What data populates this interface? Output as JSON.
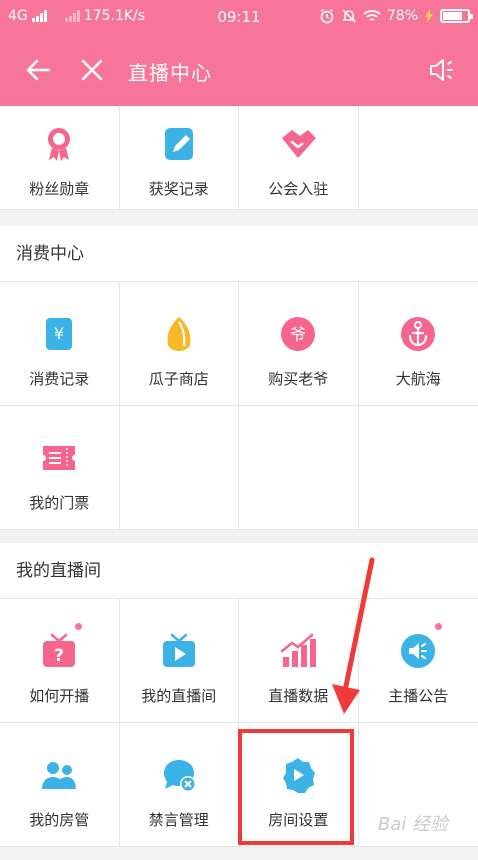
{
  "status_bar": {
    "network": "4G",
    "speed": "175.1K/s",
    "time": "09:11",
    "battery": "78%",
    "battery_level": 0.78,
    "icons": [
      "alarm-icon",
      "mute-icon",
      "wifi-icon",
      "charging-icon"
    ]
  },
  "navbar": {
    "title": "直播中心",
    "back_icon": "back-arrow-icon",
    "close_icon": "close-icon",
    "speaker_icon": "speaker-icon"
  },
  "top_row": {
    "items": [
      {
        "label": "粉丝勋章",
        "icon": "medal-icon",
        "color": "#f7648c"
      },
      {
        "label": "获奖记录",
        "icon": "edit-record-icon",
        "color": "#3bb3e6"
      },
      {
        "label": "公会入驻",
        "icon": "handshake-icon",
        "color": "#f7648c"
      }
    ]
  },
  "consumption": {
    "title": "消费中心",
    "items": [
      {
        "label": "消费记录",
        "icon": "yuan-bill-icon",
        "color": "#3bb3e6"
      },
      {
        "label": "瓜子商店",
        "icon": "melon-seed-icon",
        "color": "#f7b928"
      },
      {
        "label": "购买老爷",
        "icon": "lord-badge-icon",
        "color": "#f7648c"
      },
      {
        "label": "大航海",
        "icon": "anchor-icon",
        "color": "#f7648c"
      },
      {
        "label": "我的门票",
        "icon": "ticket-icon",
        "color": "#f7648c"
      }
    ]
  },
  "my_room": {
    "title": "我的直播间",
    "items": [
      {
        "label": "如何开播",
        "icon": "tv-question-icon",
        "color": "#f7648c",
        "dot": true
      },
      {
        "label": "我的直播间",
        "icon": "tv-play-icon",
        "color": "#3bb3e6",
        "dot": false
      },
      {
        "label": "直播数据",
        "icon": "chart-up-icon",
        "color": "#f7648c",
        "dot": false
      },
      {
        "label": "主播公告",
        "icon": "announce-icon",
        "color": "#3bb3e6",
        "dot": true
      },
      {
        "label": "我的房管",
        "icon": "users-icon",
        "color": "#3bb3e6",
        "dot": false
      },
      {
        "label": "禁言管理",
        "icon": "mute-chat-icon",
        "color": "#3bb3e6",
        "dot": false
      },
      {
        "label": "房间设置",
        "icon": "room-settings-icon",
        "color": "#3bb3e6",
        "dot": false
      }
    ]
  },
  "colors": {
    "brand": "#f77598",
    "pink": "#f7648c",
    "blue": "#3bb3e6",
    "highlight": "#f03a3a"
  },
  "watermark": "Bai 经验"
}
